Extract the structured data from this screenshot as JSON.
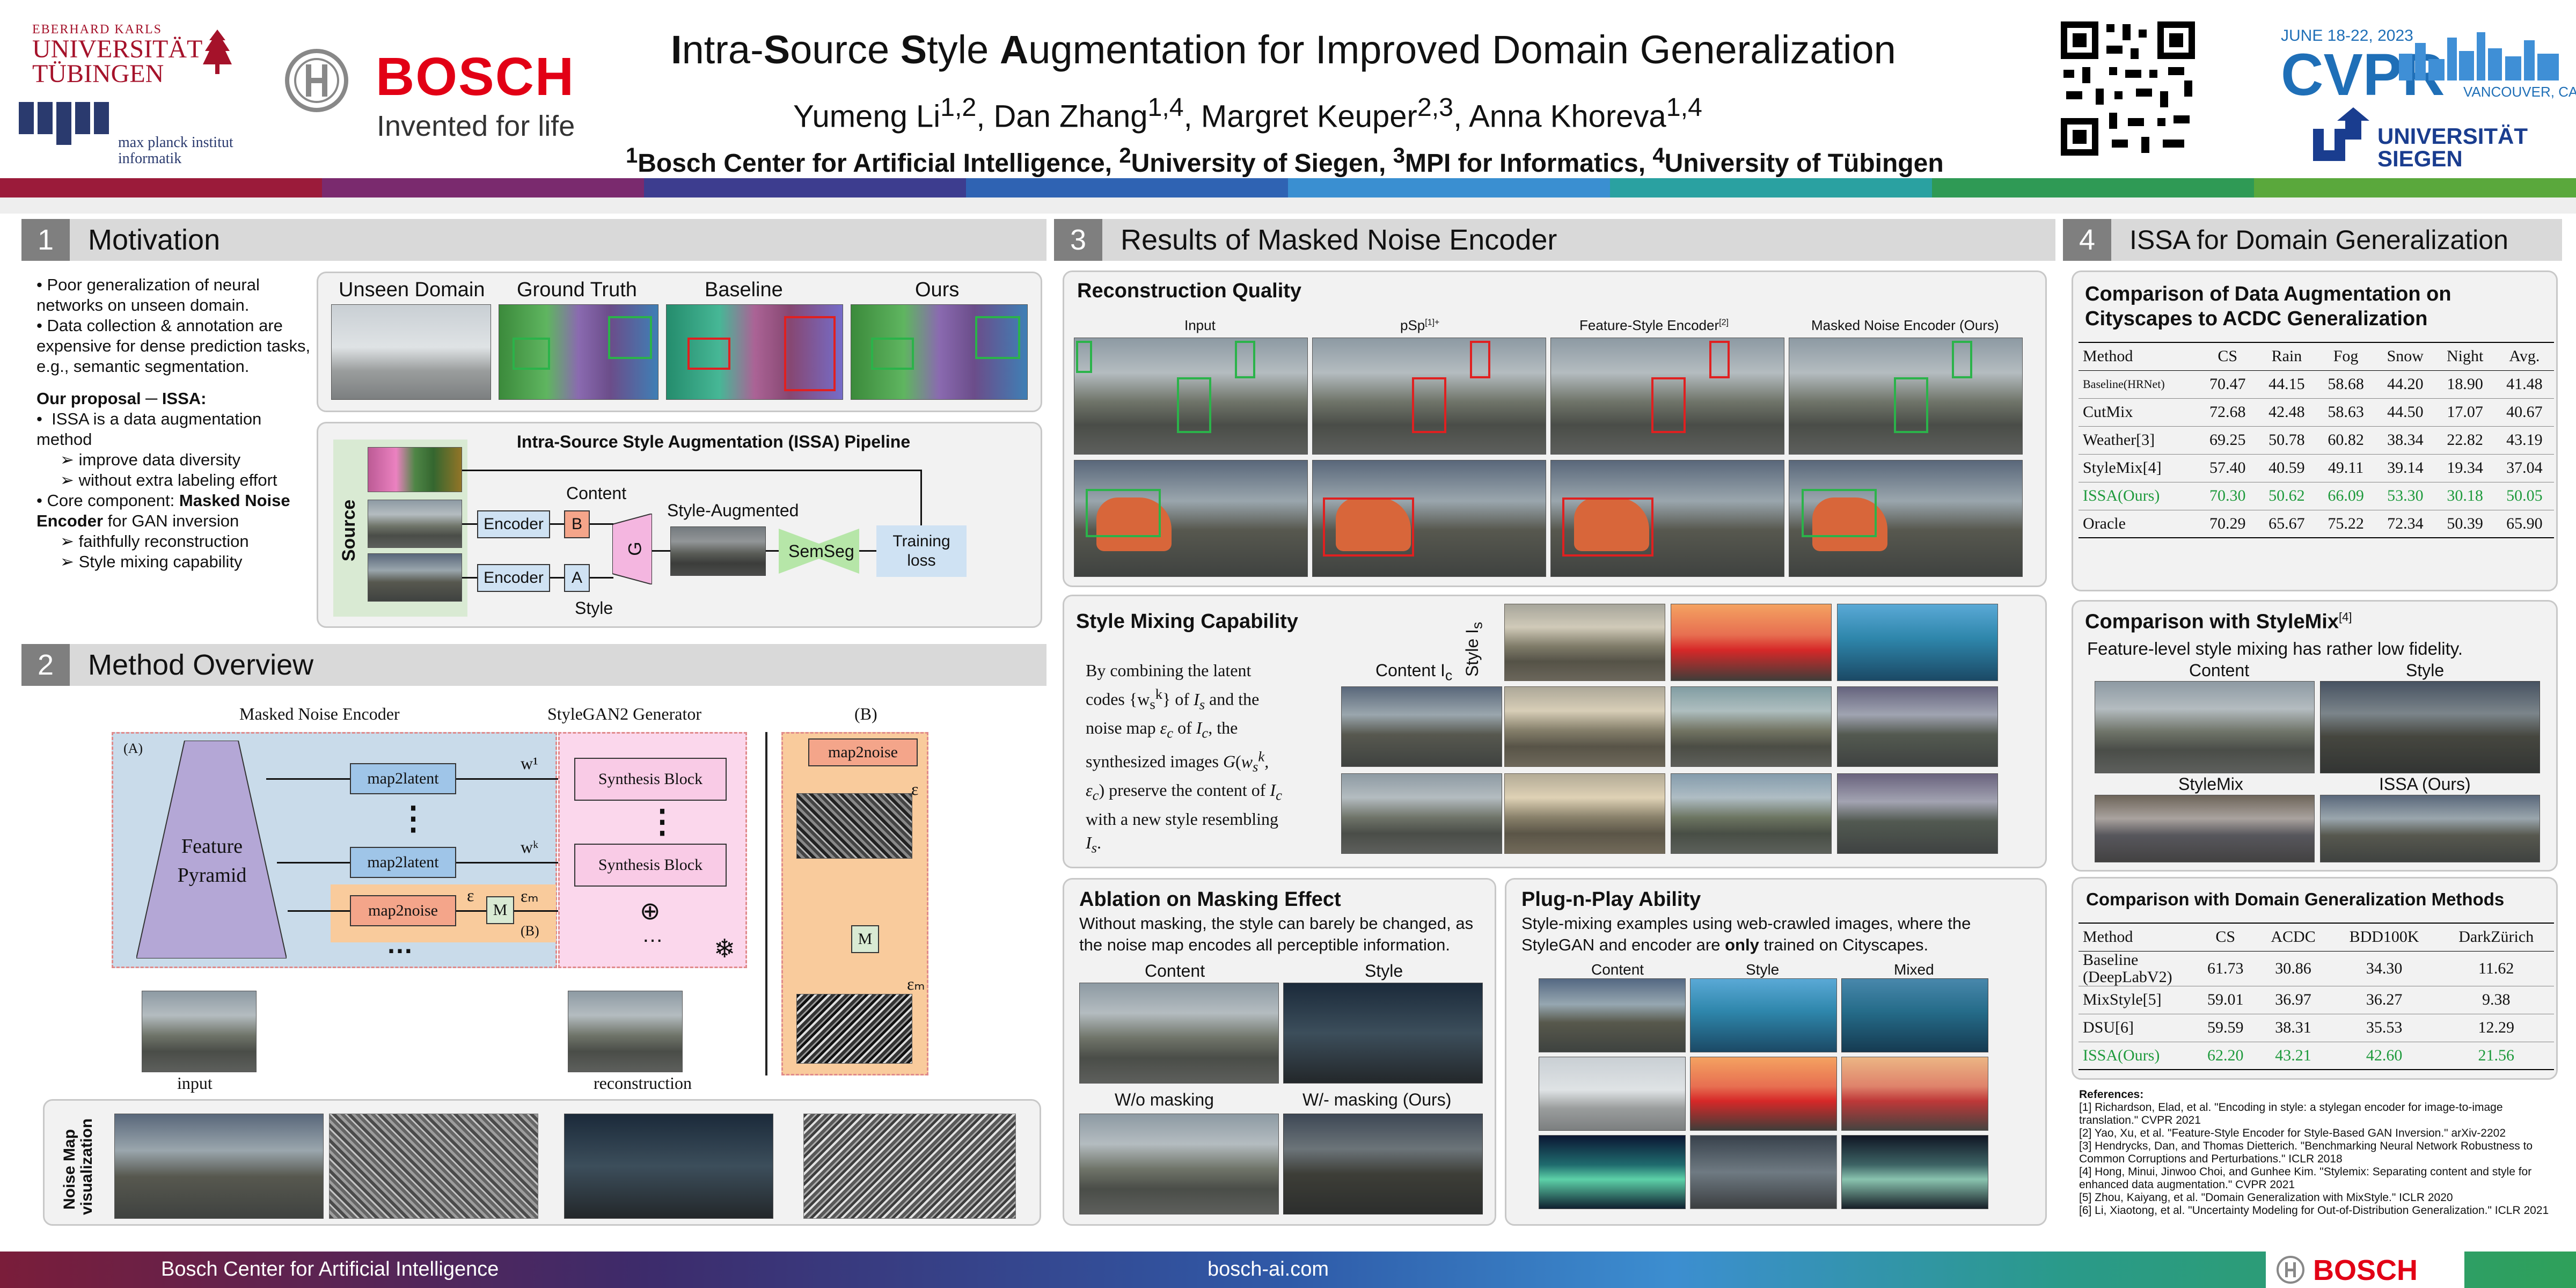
{
  "header": {
    "title_parts": [
      {
        "b": "I",
        "t": "ntra-"
      },
      {
        "b": "S",
        "t": "ource "
      },
      {
        "b": "S",
        "t": "tyle "
      },
      {
        "b": "A",
        "t": "ugmentation for Improved Domain Generalization"
      }
    ],
    "authors": "Yumeng Li<sup>1,2</sup>, Dan Zhang<sup>1,4</sup>, Margret Keuper<sup>2,3</sup>, Anna Khoreva<sup>1,4</sup>",
    "affiliations": "<sup>1</sup>Bosch Center for Artificial Intelligence, <sup>2</sup>University of Siegen, <sup>3</sup>MPI for Informatics, <sup>4</sup>University of Tübingen",
    "logos": {
      "tuebingen_line1": "EBERHARD KARLS",
      "tuebingen_line2": "UNIVERSITÄT",
      "tuebingen_line3": "TÜBINGEN",
      "mpi_text1": "max planck institut",
      "mpi_text2": "informatik",
      "bosch": "BOSCH",
      "bosch_tag": "Invented for life",
      "cvpr_date": "JUNE 18-22, 2023",
      "cvpr": "CVPR",
      "cvpr_place": "VANCOUVER, CANADA",
      "siegen1": "UNIVERSITÄT",
      "siegen2": "SIEGEN"
    },
    "stripe_colors": [
      "#9b1b3a",
      "#7a2a6e",
      "#3d3d8f",
      "#2f63b3",
      "#3a8fd1",
      "#2aa1a1",
      "#2f9a55",
      "#5aa83c"
    ]
  },
  "sec1": {
    "num": "1",
    "title": "Motivation",
    "bullets": [
      "Poor generalization of neural networks on unseen domain.",
      "Data collection & annotation are expensive for dense prediction tasks, e.g., semantic segmentation."
    ],
    "proposal": "Our proposal ─ ISSA:",
    "proposal_items": [
      "ISSA is a data augmentation method"
    ],
    "sub1": [
      "improve data diversity",
      "without extra labeling effort"
    ],
    "core_pre": "Core component: ",
    "core_bold": "Masked Noise Encoder",
    "core_post": " for GAN inversion",
    "sub2": [
      "faithfully reconstruction",
      "Style mixing capability"
    ],
    "img_labels": [
      "Unseen Domain",
      "Ground Truth",
      "Baseline",
      "Ours"
    ],
    "pipeline_title": "Intra-Source Style Augmentation (ISSA) Pipeline",
    "source": "Source",
    "encoder": "Encoder",
    "content": "Content",
    "style": "Style",
    "b": "B",
    "a": "A",
    "g": "G",
    "style_aug": "Style-Augmented",
    "semseg": "SemSeg",
    "training_loss": "Training loss"
  },
  "sec2": {
    "num": "2",
    "title": "Method Overview",
    "mne": "Masked Noise Encoder",
    "stylegan": "StyleGAN2 Generator",
    "b_label": "(B)",
    "a_label": "(A)",
    "b_inner": "(B)",
    "feature_pyramid": "Feature Pyramid",
    "map2latent": "map2latent",
    "map2noise": "map2noise",
    "synthesis": "Synthesis Block",
    "m": "M",
    "w1": "w¹",
    "wk": "wᵏ",
    "eps": "ε",
    "eps_m": "εₘ",
    "plus": "⊕",
    "dots": "…",
    "vdots": "⋮",
    "snow": "❄",
    "input": "input",
    "reconstruction": "reconstruction",
    "noise_vis": "Noise Map visualization"
  },
  "sec3": {
    "num": "3",
    "title": "Results of Masked Noise Encoder",
    "recon_title": "Reconstruction Quality",
    "recon_cols": [
      "Input",
      "pSp",
      "Feature-Style Encoder",
      "Masked Noise Encoder (Ours)"
    ],
    "recon_sups": [
      "",
      "[1]+",
      "[2]",
      ""
    ],
    "mix_title": "Style Mixing Capability",
    "mix_text": "By combining the latent codes {w<sub>s</sub><sup>k</sup>} of <i>I<sub>s</sub></i> and the noise map <i>ε<sub>c</sub></i> of <i>I<sub>c</sub></i>, the synthesized images <i>G</i>(<i>w<sub>s</sub><sup>k</sup>, ε<sub>c</sub></i>) preserve the content of <i>I<sub>c</sub></i> with a new style resembling <i>I<sub>s</sub></i>.",
    "content_ic": "Content I<sub>c</sub>",
    "style_is": "Style I<sub>s</sub>",
    "abl_title": "Ablation on Masking Effect",
    "abl_text": "Without masking, the style can barely be changed, as the noise map encodes all perceptible information.",
    "abl_labels": [
      "Content",
      "Style",
      "W/o masking",
      "W/- masking (Ours)"
    ],
    "pnp_title": "Plug-n-Play Ability",
    "pnp_text_pre": "Style-mixing examples using web-crawled images, where the StyleGAN and encoder are ",
    "pnp_bold": "only",
    "pnp_text_post": " trained on Cityscapes.",
    "pnp_labels": [
      "Content",
      "Style",
      "Mixed"
    ]
  },
  "sec4": {
    "num": "4",
    "title": "ISSA for Domain Generalization",
    "t1_title": "Comparison of Data Augmentation on Cityscapes to ACDC Generalization",
    "t1_header": [
      "Method",
      "CS",
      "Rain",
      "Fog",
      "Snow",
      "Night",
      "Avg."
    ],
    "t1_rows": [
      [
        "Baseline(HRNet)",
        "70.47",
        "44.15",
        "58.68",
        "44.20",
        "18.90",
        "41.48"
      ],
      [
        "CutMix",
        "72.68",
        "42.48",
        "58.63",
        "44.50",
        "17.07",
        "40.67"
      ],
      [
        "Weather[3]",
        "69.25",
        "50.78",
        "60.82",
        "38.34",
        "22.82",
        "43.19"
      ],
      [
        "StyleMix[4]",
        "57.40",
        "40.59",
        "49.11",
        "39.14",
        "19.34",
        "37.04"
      ],
      [
        "ISSA(Ours)",
        "70.30",
        "50.62",
        "66.09",
        "53.30",
        "30.18",
        "50.05"
      ],
      [
        "Oracle",
        "70.29",
        "65.67",
        "75.22",
        "72.34",
        "50.39",
        "65.90"
      ]
    ],
    "sm_title": "Comparison with StyleMix",
    "sm_sup": "[4]",
    "sm_text": "Feature-level style mixing has rather low fidelity.",
    "sm_labels": [
      "Content",
      "Style",
      "StyleMix",
      "ISSA (Ours)"
    ],
    "t2_title": "Comparison with Domain Generalization Methods",
    "t2_header": [
      "Method",
      "CS",
      "ACDC",
      "BDD100K",
      "DarkZürich"
    ],
    "t2_rows": [
      [
        "Baseline (DeepLabV2)",
        "61.73",
        "30.86",
        "34.30",
        "11.62"
      ],
      [
        "MixStyle[5]",
        "59.01",
        "36.97",
        "36.27",
        "9.38"
      ],
      [
        "DSU[6]",
        "59.59",
        "38.31",
        "35.53",
        "12.29"
      ],
      [
        "ISSA(Ours)",
        "62.20",
        "43.21",
        "42.60",
        "21.56"
      ]
    ],
    "refs_title": "References:",
    "refs": [
      "[1] Richardson, Elad, et al. \"Encoding in style: a stylegan encoder for image-to-image translation.\" CVPR 2021",
      "[2] Yao, Xu, et al. \"Feature-Style Encoder for Style-Based GAN Inversion.\" arXiv-2202",
      "[3] Hendrycks, Dan, and Thomas Dietterich. \"Benchmarking Neural Network Robustness to Common Corruptions and Perturbations.\" ICLR 2018",
      "[4] Hong, Minui, Jinwoo Choi, and Gunhee Kim. \"Stylemix: Separating content and style for enhanced data augmentation.\" CVPR 2021",
      "[5] Zhou, Kaiyang, et al. \"Domain Generalization with MixStyle.\" ICLR 2020",
      "[6] Li, Xiaotong, et al. \"Uncertainty Modeling for Out-of-Distribution Generalization.\" ICLR 2021"
    ]
  },
  "footer": {
    "left": "Bosch Center for Artificial Intelligence",
    "center": "bosch-ai.com",
    "bosch": "BOSCH"
  }
}
